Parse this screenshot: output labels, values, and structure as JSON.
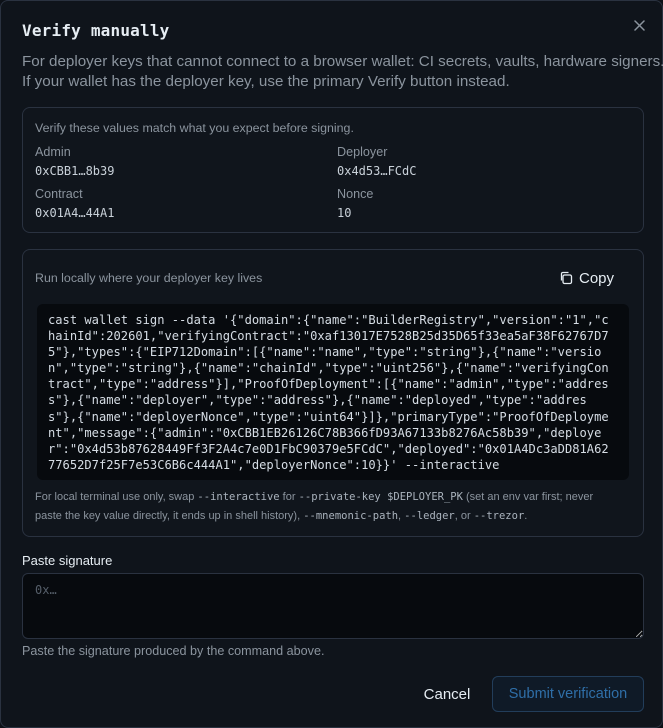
{
  "dialog": {
    "title": "Verify manually",
    "subtitle_lines": [
      "For deployer keys that cannot connect to a browser wallet: CI secrets, vaults, hardware signers.",
      "If your wallet has the deployer key, use the primary Verify button instead."
    ]
  },
  "values_card": {
    "note": "Verify these values match what you expect before signing.",
    "admin_label": "Admin",
    "admin_value": "0xCBB1…8b39",
    "deployer_label": "Deployer",
    "deployer_value": "0x4d53…FCdC",
    "contract_label": "Contract",
    "contract_value": "0x01A4…44A1",
    "nonce_label": "Nonce",
    "nonce_value": "10"
  },
  "command_card": {
    "note": "Run locally where your deployer key lives",
    "copy_label": "Copy",
    "code_lines": [
      "cast wallet sign --data '{\"domain\":{\"name\":\"BuilderRegistry\",\"version\":\"1\",\"c",
      "hainId\":202601,\"verifyingContract\":\"0xaf13017E7528B25d35D65f33ea5aF38F62767D7",
      "5\"},\"types\":{\"EIP712Domain\":[{\"name\":\"name\",\"type\":\"string\"},{\"name\":\"versio",
      "n\",\"type\":\"string\"},{\"name\":\"chainId\",\"type\":\"uint256\"},{\"name\":\"verifyingCon",
      "tract\",\"type\":\"address\"}],\"ProofOfDeployment\":[{\"name\":\"admin\",\"type\":\"addres",
      "s\"},{\"name\":\"deployer\",\"type\":\"address\"},{\"name\":\"deployed\",\"type\":\"addres",
      "s\"},{\"name\":\"deployerNonce\",\"type\":\"uint64\"}]},\"primaryType\":\"ProofOfDeployme",
      "nt\",\"message\":{\"admin\":\"0xCBB1EB26126C78B366fD93A67133b8276Ac58b39\",\"deploye",
      "r\":\"0x4d53b87628449Ff3F2A4c7e0D1FbC90379e5FCdC\",\"deployed\":\"0x01A4Dc3aDD81A62",
      "77652D7f25F7e53C6B6c444A1\",\"deployerNonce\":10}}' --interactive"
    ],
    "footnote": {
      "t1": "For local terminal use only, swap ",
      "c1": "--interactive",
      "t2": " for ",
      "c2": "--private-key $DEPLOYER_PK",
      "t3": " (set an env var first; never",
      "t4": "paste the key value directly, it ends up in shell history), ",
      "c3": "--mnemonic-path",
      "t5": ", ",
      "c4": "--ledger",
      "t6": ", or ",
      "c5": "--trezor",
      "t7": "."
    }
  },
  "signature": {
    "label": "Paste signature",
    "placeholder": "0x…",
    "value": "",
    "hint": "Paste the signature produced by the command above."
  },
  "actions": {
    "cancel_label": "Cancel",
    "submit_label": "Submit verification"
  },
  "colors": {
    "background": "#0f141b",
    "border": "#2a3240",
    "code_background": "#070a0e",
    "submit_text_disabled": "#2f6fa8"
  },
  "icons": {
    "close": "close-icon",
    "copy": "copy-icon"
  }
}
